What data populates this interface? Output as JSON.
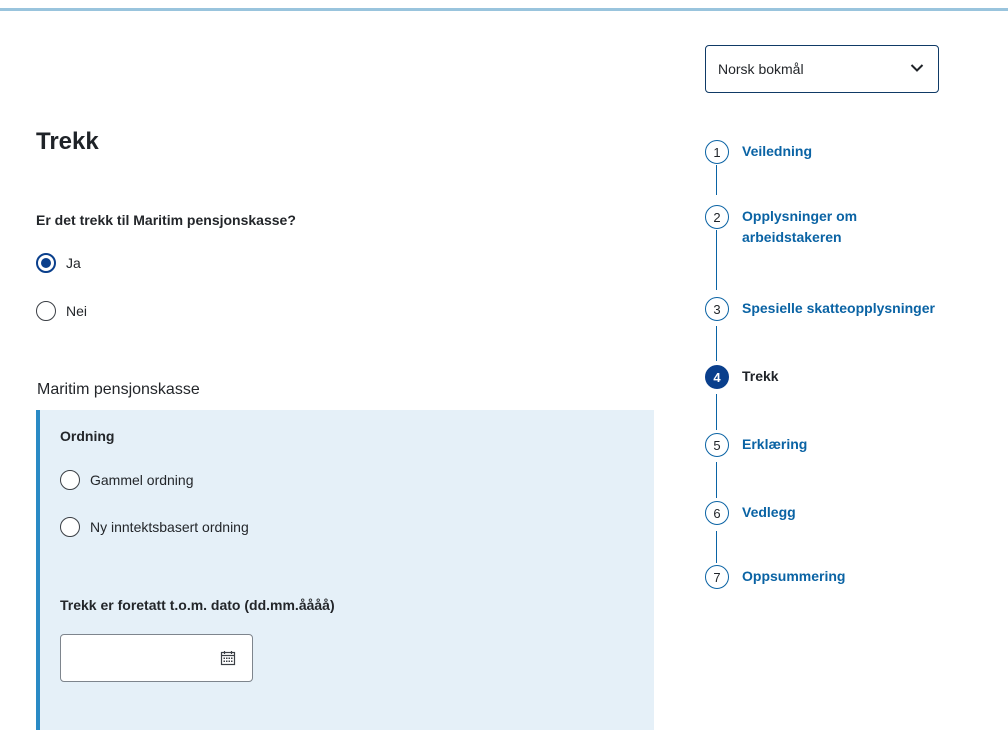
{
  "language_select": {
    "value": "Norsk bokmål",
    "icon": "chevron-down-icon"
  },
  "page": {
    "title": "Trekk"
  },
  "question": {
    "label": "Er det trekk til Maritim pensjonskasse?",
    "options": [
      {
        "label": "Ja",
        "checked": true
      },
      {
        "label": "Nei",
        "checked": false
      }
    ]
  },
  "section": {
    "label": "Maritim pensjonskasse",
    "ordning": {
      "heading": "Ordning",
      "options": [
        {
          "label": "Gammel ordning",
          "checked": false
        },
        {
          "label": "Ny inntektsbasert ordning",
          "checked": false
        }
      ]
    },
    "date": {
      "label": "Trekk er foretatt t.o.m. dato (dd.mm.åååå)",
      "value": "",
      "icon": "calendar-icon"
    }
  },
  "stepper": {
    "steps": [
      {
        "number": "1",
        "label_line1": "Veiledning",
        "label_line2": "",
        "active": false
      },
      {
        "number": "2",
        "label_line1": "Opplysninger om",
        "label_line2": "arbeidstakeren",
        "active": false
      },
      {
        "number": "3",
        "label_line1": "Spesielle skatteopplysninger",
        "label_line2": "",
        "active": false
      },
      {
        "number": "4",
        "label_line1": "Trekk",
        "label_line2": "",
        "active": true
      },
      {
        "number": "5",
        "label_line1": "Erklæring",
        "label_line2": "",
        "active": false
      },
      {
        "number": "6",
        "label_line1": "Vedlegg",
        "label_line2": "",
        "active": false
      },
      {
        "number": "7",
        "label_line1": "Oppsummering",
        "label_line2": "",
        "active": false
      }
    ]
  },
  "colors": {
    "accent": "#0a63a4",
    "active_step": "#0a3f8c",
    "panel_background": "#e5f0f8",
    "panel_border": "#2a8ac5"
  }
}
